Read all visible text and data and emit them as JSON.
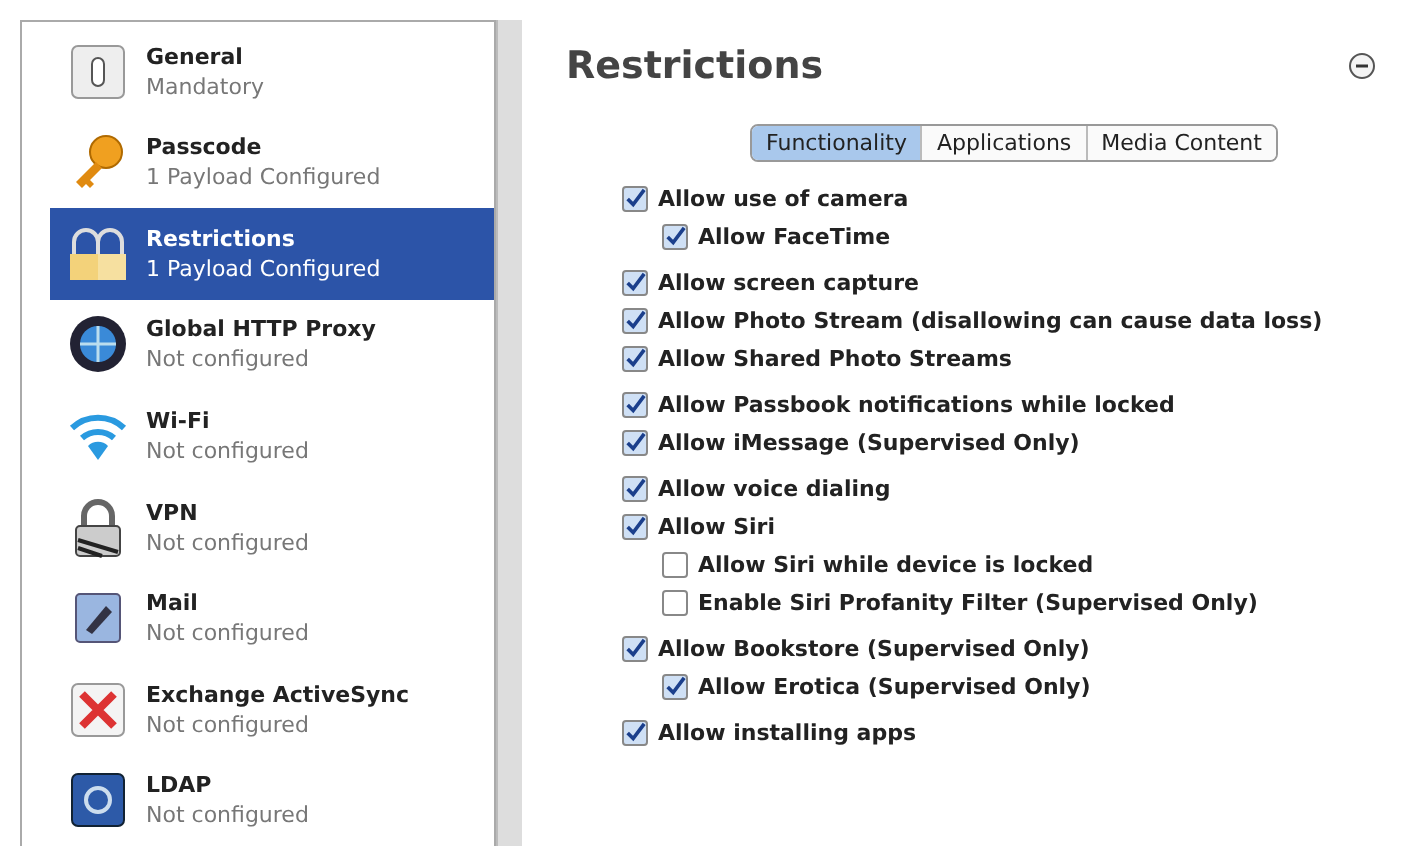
{
  "sidebar": {
    "items": [
      {
        "title": "General",
        "subtitle": "Mandatory",
        "selected": false
      },
      {
        "title": "Passcode",
        "subtitle": "1 Payload Configured",
        "selected": false
      },
      {
        "title": "Restrictions",
        "subtitle": "1 Payload Configured",
        "selected": true
      },
      {
        "title": "Global HTTP Proxy",
        "subtitle": "Not configured",
        "selected": false
      },
      {
        "title": "Wi-Fi",
        "subtitle": "Not configured",
        "selected": false
      },
      {
        "title": "VPN",
        "subtitle": "Not configured",
        "selected": false
      },
      {
        "title": "Mail",
        "subtitle": "Not configured",
        "selected": false
      },
      {
        "title": "Exchange ActiveSync",
        "subtitle": "Not configured",
        "selected": false
      },
      {
        "title": "LDAP",
        "subtitle": "Not configured",
        "selected": false
      }
    ]
  },
  "content": {
    "title": "Restrictions",
    "tabs": [
      {
        "label": "Functionality",
        "selected": true
      },
      {
        "label": "Applications",
        "selected": false
      },
      {
        "label": "Media Content",
        "selected": false
      }
    ],
    "groups": [
      [
        {
          "label": "Allow use of camera",
          "checked": true,
          "children": [
            {
              "label": "Allow FaceTime",
              "checked": true
            }
          ]
        }
      ],
      [
        {
          "label": "Allow screen capture",
          "checked": true
        },
        {
          "label": "Allow Photo Stream (disallowing can cause data loss)",
          "checked": true
        },
        {
          "label": "Allow Shared Photo Streams",
          "checked": true
        }
      ],
      [
        {
          "label": "Allow Passbook notifications while locked",
          "checked": true
        },
        {
          "label": "Allow iMessage (Supervised Only)",
          "checked": true
        }
      ],
      [
        {
          "label": "Allow voice dialing",
          "checked": true
        },
        {
          "label": "Allow Siri",
          "checked": true,
          "children": [
            {
              "label": "Allow Siri while device is locked",
              "checked": false
            },
            {
              "label": "Enable Siri Profanity Filter (Supervised Only)",
              "checked": false
            }
          ]
        }
      ],
      [
        {
          "label": "Allow Bookstore (Supervised Only)",
          "checked": true,
          "children": [
            {
              "label": "Allow Erotica (Supervised Only)",
              "checked": true
            }
          ]
        }
      ],
      [
        {
          "label": "Allow installing apps",
          "checked": true
        }
      ]
    ]
  }
}
